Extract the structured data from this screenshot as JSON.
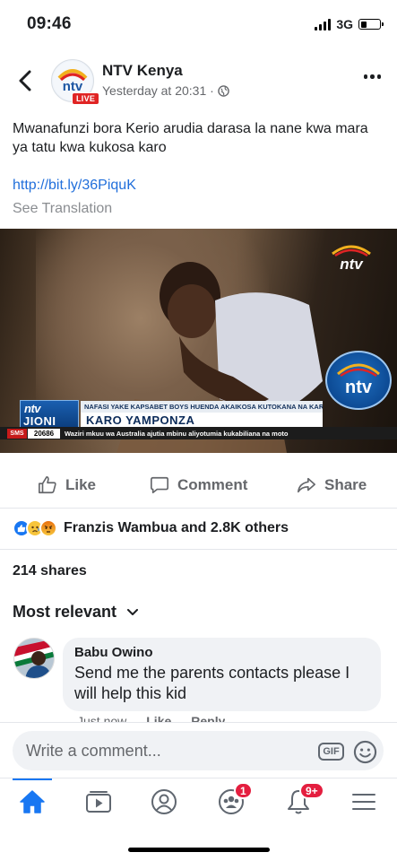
{
  "status_bar": {
    "time": "09:46",
    "network": "3G"
  },
  "post": {
    "page_name": "NTV Kenya",
    "live_badge": "LIVE",
    "timestamp": "Yesterday at 20:31 ·",
    "text": "Mwanafunzi bora Kerio arudia darasa la nane kwa mara ya tatu kwa kukosa karo",
    "link": "http://bit.ly/36PiquK",
    "see_translation": "See Translation"
  },
  "video": {
    "logo_top": "ntv",
    "lower_third": {
      "logo_line1": "ntv",
      "logo_line2": "JIONI",
      "small_headline": "NAFASI YAKE KAPSABET BOYS HUENDA AKAIKOSA KUTOKANA NA KARO",
      "big_headline": "KARO YAMPONZA"
    },
    "ticker": {
      "sms_label": "SMS",
      "sms_number": "20686",
      "text": "Waziri mkuu wa Australia ajutia mbinu aliyotumia kukabiliana na moto"
    },
    "bug_text": "ntv"
  },
  "actions": {
    "like": "Like",
    "comment": "Comment",
    "share": "Share"
  },
  "reactions": {
    "summary": "Franzis Wambua and 2.8K others",
    "icons": [
      "like-icon",
      "sad-icon",
      "angry-icon"
    ]
  },
  "shares": "214 shares",
  "comments_filter": "Most relevant",
  "comment": {
    "author": "Babu Owino",
    "text": "Send me the parents contacts please I will help this kid",
    "time": "Just now",
    "like": "Like",
    "reply": "Reply"
  },
  "composer": {
    "placeholder": "Write a comment...",
    "gif": "GIF"
  },
  "bottom_nav": {
    "groups_badge": "1",
    "notifications_badge": "9+"
  },
  "colors": {
    "accent": "#1877f2",
    "link": "#216fdb",
    "badge": "#e41e3f"
  }
}
